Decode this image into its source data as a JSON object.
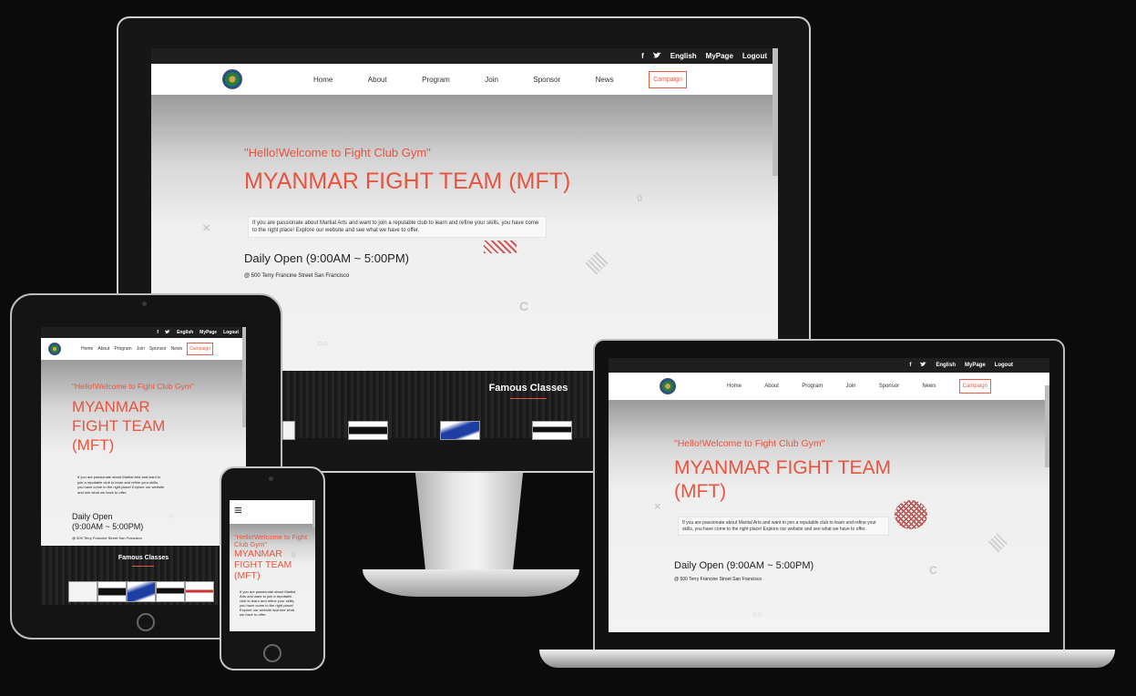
{
  "nav": {
    "facebook_icon": "f",
    "twitter_icon": "twitter",
    "language": "English",
    "mypage": "MyPage",
    "logout": "Logout",
    "menu_icon": "≡",
    "items": [
      "Home",
      "About",
      "Program",
      "Join",
      "Sponsor",
      "News"
    ],
    "campaign": "Campaign"
  },
  "hero": {
    "greeting": "\"Hello!Welcome to Fight Club Gym\"",
    "title": "MYANMAR FIGHT TEAM (MFT)",
    "title_line1": "MYANMAR",
    "title_line2": "FIGHT TEAM",
    "title_line3": "(MFT)",
    "title_wrap_a": "MYANMAR FIGHT TEAM",
    "description": "If you are passionate about Martial Arts and want to join a reputable club to learn and refine your skills, you have come to the right place! Explore our website and see what we have to offer.",
    "hours": "Daily Open (9:00AM ~ 5:00PM)",
    "hours_line1": "Daily Open",
    "hours_line2": "(9:00AM ~ 5:00PM)",
    "address": "@ 500 Terry Francine Street San Francisco"
  },
  "classes": {
    "heading": "Famous Classes"
  },
  "colors": {
    "accent": "#e8543f",
    "topbar": "#1f1f1f",
    "background": "#0b0b0b"
  }
}
